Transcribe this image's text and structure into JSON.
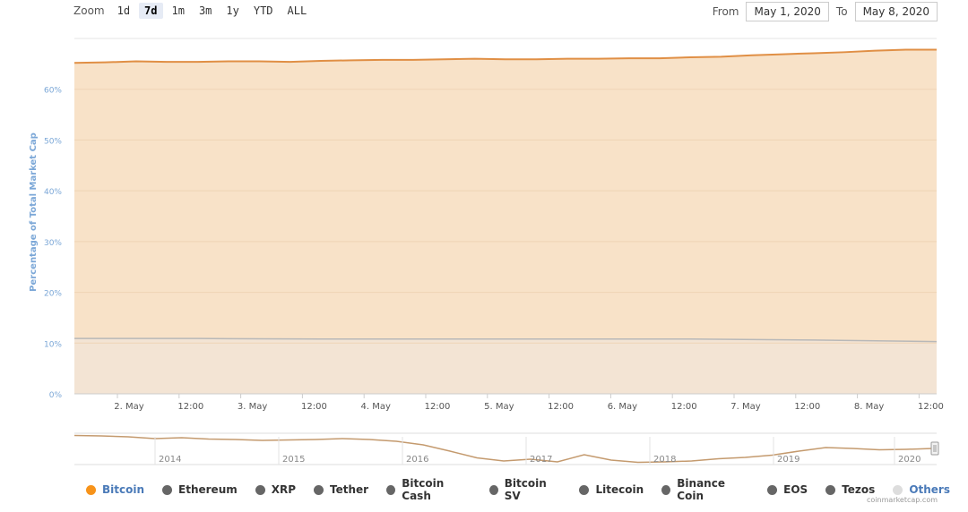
{
  "zoom": {
    "label": "Zoom",
    "buttons": [
      "1d",
      "7d",
      "1m",
      "3m",
      "1y",
      "YTD",
      "ALL"
    ],
    "active": "7d"
  },
  "range": {
    "from_label": "From",
    "from_value": "May 1, 2020",
    "to_label": "To",
    "to_value": "May 8, 2020"
  },
  "chart_data": {
    "type": "area",
    "ylabel": "Percentage of Total Market Cap",
    "ylim": [
      0,
      70
    ],
    "y_ticks": [
      "0%",
      "10%",
      "20%",
      "30%",
      "40%",
      "50%",
      "60%"
    ],
    "x_tick_labels": [
      "2. May",
      "12:00",
      "3. May",
      "12:00",
      "4. May",
      "12:00",
      "5. May",
      "12:00",
      "6. May",
      "12:00",
      "7. May",
      "12:00",
      "8. May",
      "12:00"
    ],
    "x_start": "May 1, 2020 15:00",
    "grid": true,
    "series": [
      {
        "name": "Bitcoin",
        "color": "#f7931a",
        "x": [
          "2020-05-01 15:00",
          "2020-05-01 21:00",
          "2020-05-02 03:00",
          "2020-05-02 09:00",
          "2020-05-02 15:00",
          "2020-05-02 21:00",
          "2020-05-03 03:00",
          "2020-05-03 09:00",
          "2020-05-03 15:00",
          "2020-05-03 21:00",
          "2020-05-04 03:00",
          "2020-05-04 09:00",
          "2020-05-04 15:00",
          "2020-05-04 21:00",
          "2020-05-05 03:00",
          "2020-05-05 09:00",
          "2020-05-05 15:00",
          "2020-05-05 21:00",
          "2020-05-06 03:00",
          "2020-05-06 09:00",
          "2020-05-06 15:00",
          "2020-05-06 21:00",
          "2020-05-07 03:00",
          "2020-05-07 09:00",
          "2020-05-07 15:00",
          "2020-05-07 21:00",
          "2020-05-08 03:00",
          "2020-05-08 09:00",
          "2020-05-08 15:00"
        ],
        "values": [
          65.2,
          65.3,
          65.5,
          65.4,
          65.4,
          65.5,
          65.5,
          65.4,
          65.6,
          65.7,
          65.8,
          65.8,
          65.9,
          66.0,
          65.9,
          65.9,
          66.0,
          66.0,
          66.1,
          66.1,
          66.3,
          66.4,
          66.7,
          66.9,
          67.1,
          67.3,
          67.6,
          67.8,
          67.8
        ]
      },
      {
        "name": "Ethereum",
        "color": "#666666",
        "x": [
          "2020-05-01 15:00",
          "2020-05-02 15:00",
          "2020-05-03 15:00",
          "2020-05-04 15:00",
          "2020-05-05 15:00",
          "2020-05-06 15:00",
          "2020-05-07 15:00",
          "2020-05-08 15:00"
        ],
        "values": [
          10.9,
          10.9,
          10.8,
          10.8,
          10.8,
          10.8,
          10.6,
          10.3
        ]
      }
    ],
    "navigator": {
      "year_labels": [
        "2014",
        "2015",
        "2016",
        "2017",
        "2018",
        "2019",
        "2020"
      ],
      "values": [
        95,
        94,
        92,
        88,
        90,
        87,
        86,
        84,
        85,
        86,
        88,
        86,
        82,
        74,
        60,
        45,
        38,
        42,
        36,
        52,
        40,
        35,
        36,
        38,
        43,
        46,
        51,
        60,
        68,
        66,
        63,
        64,
        66
      ]
    }
  },
  "legend": [
    {
      "label": "Bitcoin",
      "color": "#f7931a",
      "text_color": "#4a7ab8"
    },
    {
      "label": "Ethereum",
      "color": "#666666",
      "text_color": "#333333"
    },
    {
      "label": "XRP",
      "color": "#666666",
      "text_color": "#333333"
    },
    {
      "label": "Tether",
      "color": "#666666",
      "text_color": "#333333"
    },
    {
      "label": "Bitcoin Cash",
      "color": "#666666",
      "text_color": "#333333"
    },
    {
      "label": "Bitcoin SV",
      "color": "#666666",
      "text_color": "#333333"
    },
    {
      "label": "Litecoin",
      "color": "#666666",
      "text_color": "#333333"
    },
    {
      "label": "Binance Coin",
      "color": "#666666",
      "text_color": "#333333"
    },
    {
      "label": "EOS",
      "color": "#666666",
      "text_color": "#333333"
    },
    {
      "label": "Tezos",
      "color": "#666666",
      "text_color": "#333333"
    },
    {
      "label": "Others",
      "color": "#dddddd",
      "text_color": "#4a7ab8"
    }
  ],
  "credit": "coinmarketcap.com"
}
